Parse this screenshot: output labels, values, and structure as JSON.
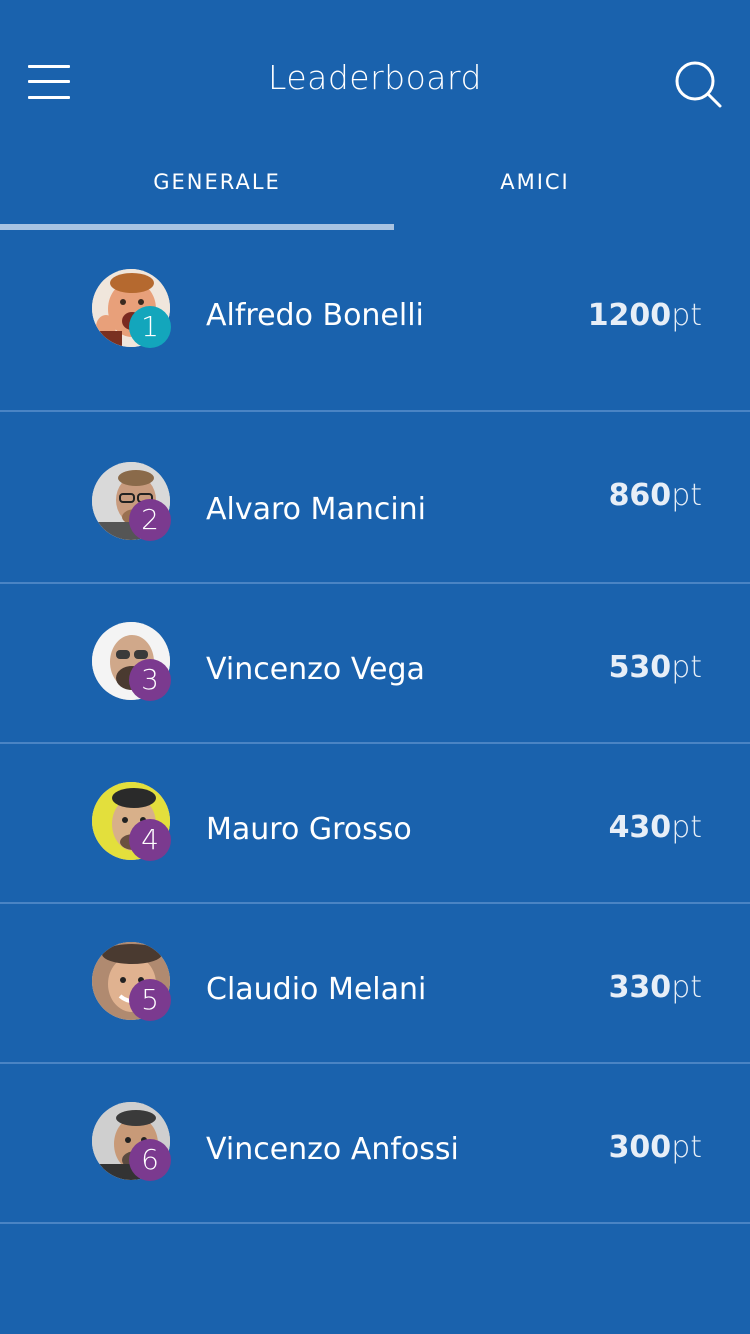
{
  "header": {
    "title": "Leaderboard",
    "menu_icon": "hamburger-menu-icon",
    "search_icon": "search-icon"
  },
  "tabs": [
    {
      "label": "GENERALE",
      "active": true
    },
    {
      "label": "AMICI",
      "active": false
    }
  ],
  "colors": {
    "background": "#1a62ad",
    "tab_indicator": "#a8c3e2",
    "first_badge": "#13a6bc",
    "other_badge": "#7b3a8f",
    "separator": "#4a84c4"
  },
  "leaderboard": [
    {
      "rank": "1",
      "name": "Alfredo Bonelli",
      "points": "1200",
      "unit": "pt"
    },
    {
      "rank": "2",
      "name": "Alvaro Mancini",
      "points": "860",
      "unit": "pt"
    },
    {
      "rank": "3",
      "name": "Vincenzo Vega",
      "points": "530",
      "unit": "pt"
    },
    {
      "rank": "4",
      "name": "Mauro Grosso",
      "points": "430",
      "unit": "pt"
    },
    {
      "rank": "5",
      "name": "Claudio Melani",
      "points": "330",
      "unit": "pt"
    },
    {
      "rank": "6",
      "name": "Vincenzo Anfossi",
      "points": "300",
      "unit": "pt"
    }
  ]
}
